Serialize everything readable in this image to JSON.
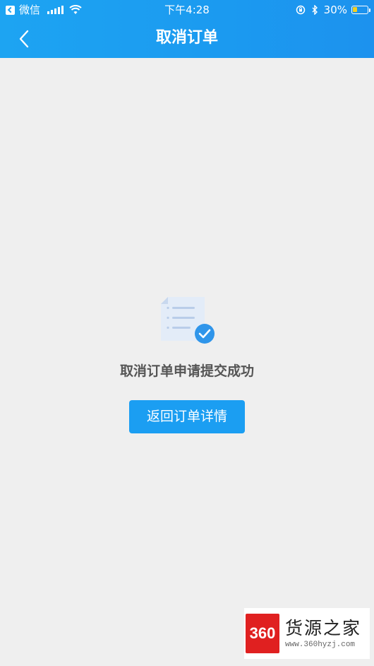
{
  "status_bar": {
    "carrier": "微信",
    "time": "下午4:28",
    "battery_percent": "30%",
    "battery_level": 0.3
  },
  "nav": {
    "title": "取消订单"
  },
  "content": {
    "success_message": "取消订单申请提交成功",
    "detail_button_label": "返回订单详情"
  },
  "watermark": {
    "logo_text": "360",
    "name": "货源之家",
    "url": "www.360hyzj.com"
  },
  "colors": {
    "accent": "#1b9ef2",
    "background": "#efefef"
  }
}
